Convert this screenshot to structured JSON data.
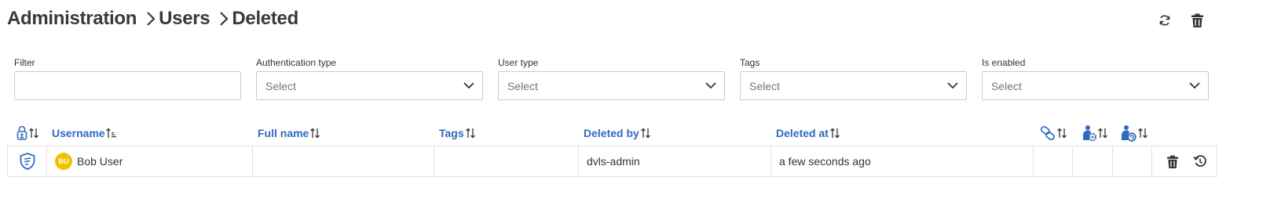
{
  "breadcrumb": {
    "items": [
      "Administration",
      "Users",
      "Deleted"
    ]
  },
  "top_actions": {
    "refresh_icon": "refresh-icon",
    "delete_icon": "trash-icon"
  },
  "filters": {
    "filter": {
      "label": "Filter",
      "value": ""
    },
    "authentication_type": {
      "label": "Authentication type",
      "placeholder": "Select"
    },
    "user_type": {
      "label": "User type",
      "placeholder": "Select"
    },
    "tags": {
      "label": "Tags",
      "placeholder": "Select"
    },
    "is_enabled": {
      "label": "Is enabled",
      "placeholder": "Select"
    }
  },
  "table": {
    "columns": {
      "auth": {
        "icon": "lock-user-icon"
      },
      "username": "Username",
      "full_name": "Full name",
      "tags": "Tags",
      "deleted_by": "Deleted by",
      "deleted_at": "Deleted at",
      "linked": {
        "icon": "link-icon"
      },
      "user_settings": {
        "icon": "user-gear-icon"
      },
      "user_permissions": {
        "icon": "user-settings-icon"
      }
    },
    "rows": [
      {
        "auth_icon": "shield-icon",
        "avatar_initials": "BU",
        "username": "Bob User",
        "full_name": "",
        "tags": "",
        "deleted_by": "dvls-admin",
        "deleted_at": "a few seconds ago"
      }
    ]
  },
  "colors": {
    "link_blue": "#2f6bbf",
    "avatar_yellow": "#f2c200",
    "title_text": "#3a3a3a"
  }
}
